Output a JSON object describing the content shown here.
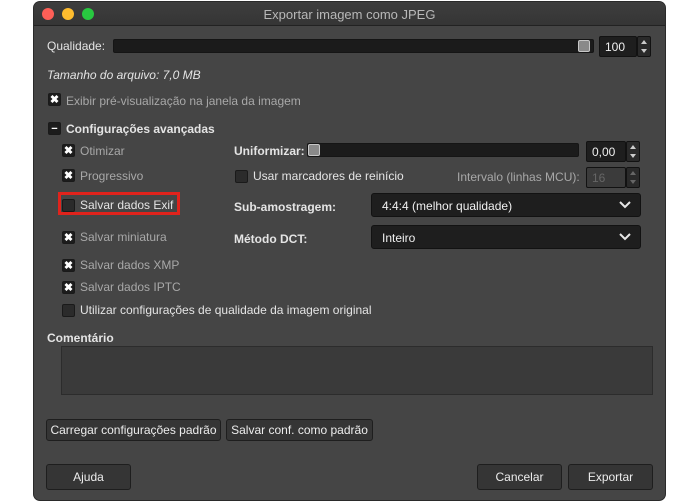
{
  "window": {
    "title": "Exportar imagem como JPEG"
  },
  "quality": {
    "label": "Qualidade:",
    "value": "100"
  },
  "file_size": "Tamanho do arquivo: 7,0 MB",
  "preview": {
    "label": "Exibir pré-visualização na janela da imagem",
    "checked": true
  },
  "advanced": {
    "header": "Configurações avançadas",
    "options": {
      "optimize": "Otimizar",
      "progressive": "Progressivo",
      "save_exif": "Salvar dados Exif",
      "save_thumbnail": "Salvar miniatura",
      "save_xmp": "Salvar dados XMP",
      "save_iptc": "Salvar dados IPTC",
      "use_original_quality": "Utilizar configurações de qualidade da imagem original"
    },
    "smoothing": {
      "label": "Uniformizar:",
      "value": "0,00"
    },
    "restart_markers": {
      "label": "Usar marcadores de reinício",
      "checked": false
    },
    "interval": {
      "label": "Intervalo (linhas MCU):",
      "value": "16"
    },
    "subsampling": {
      "label": "Sub-amostragem:",
      "value": "4:4:4 (melhor qualidade)"
    },
    "dct": {
      "label": "Método DCT:",
      "value": "Inteiro"
    }
  },
  "comment": {
    "label": "Comentário",
    "value": ""
  },
  "buttons": {
    "load_defaults": "Carregar configurações padrão",
    "save_defaults": "Salvar conf. como padrão",
    "help": "Ajuda",
    "cancel": "Cancelar",
    "export": "Exportar"
  },
  "colors": {
    "highlight": "#e0231c",
    "background": "#454545"
  },
  "icons": {
    "check": "✖",
    "collapse": "−",
    "chevron": "chevron-down"
  }
}
